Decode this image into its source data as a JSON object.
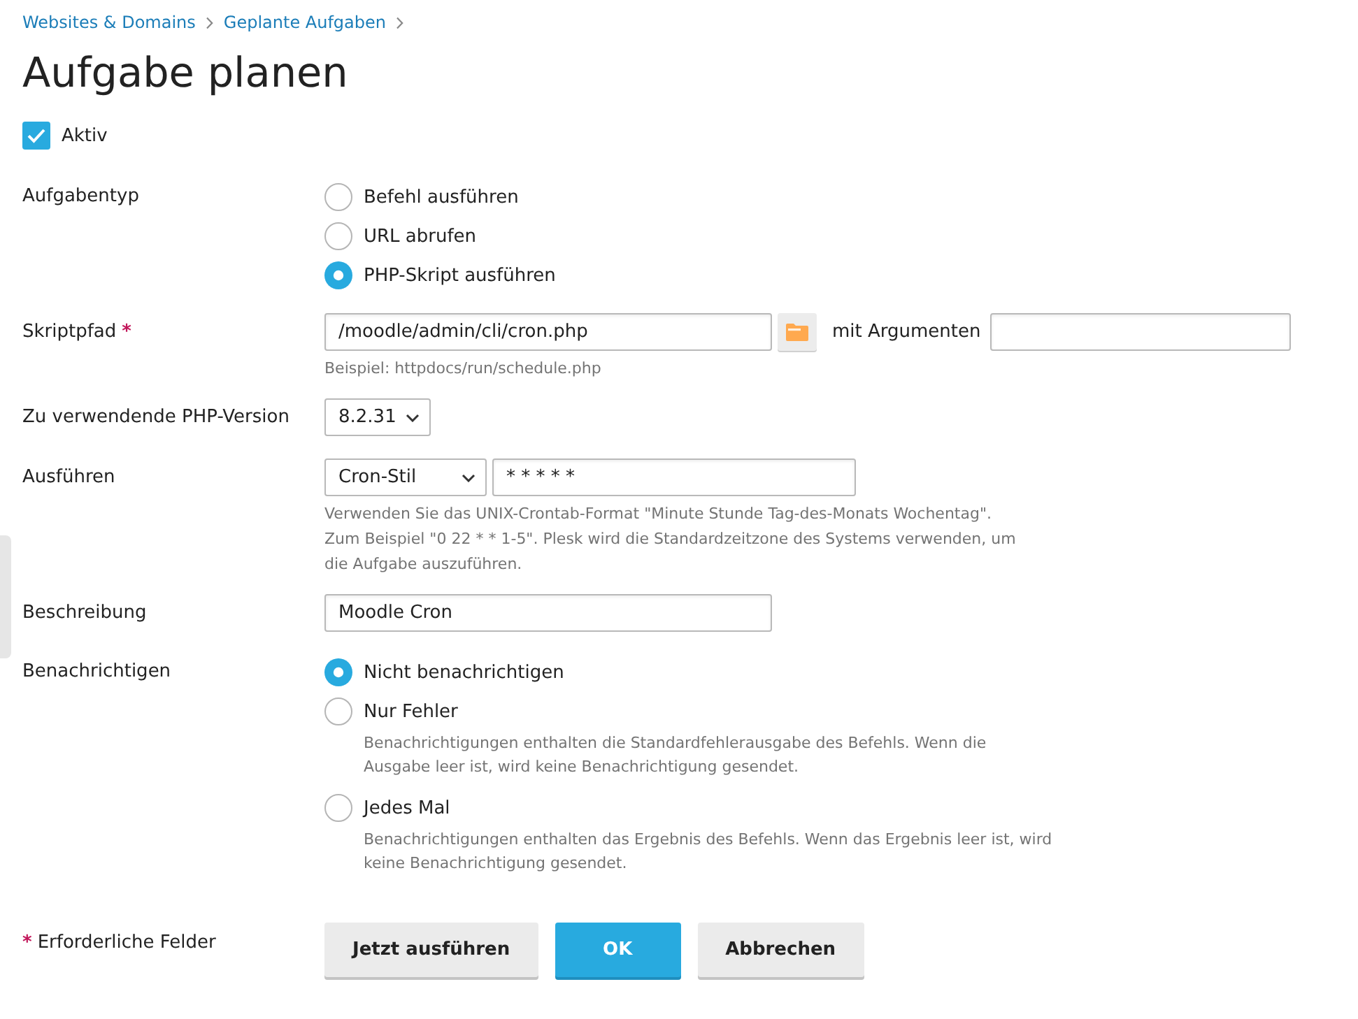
{
  "breadcrumbs": [
    {
      "label": "Websites & Domains"
    },
    {
      "label": "Geplante Aufgaben"
    }
  ],
  "title": "Aufgabe planen",
  "active": {
    "label": "Aktiv",
    "checked": true
  },
  "fields": [
    {
      "kind": "radio",
      "label": "Aufgabentyp",
      "options": [
        {
          "label": "Befehl ausführen",
          "selected": false
        },
        {
          "label": "URL abrufen",
          "selected": false
        },
        {
          "label": "PHP-Skript ausführen",
          "selected": true
        }
      ]
    },
    {
      "kind": "path",
      "label": "Skriptpfad",
      "required_mark": "*",
      "value": "/moodle/admin/cli/cron.php",
      "args_label": "mit Argumenten",
      "hint": "Beispiel: httpdocs/run/schedule.php"
    },
    {
      "kind": "select",
      "label": "Zu verwendende PHP-Version",
      "value": "8.2.31"
    },
    {
      "kind": "schedule",
      "label": "Ausführen",
      "mode": "Cron-Stil",
      "value": "* * * * *",
      "hint": "Verwenden Sie das UNIX-Crontab-Format \"Minute Stunde Tag-des-Monats Wochentag\". Zum Beispiel \"0 22 * * 1-5\". Plesk wird die Standardzeitzone des Systems verwenden, um die Aufgabe auszuführen."
    },
    {
      "kind": "text",
      "label": "Beschreibung",
      "value": "Moodle Cron"
    },
    {
      "kind": "radio",
      "label": "Benachrichtigen",
      "options": [
        {
          "label": "Nicht benachrichtigen",
          "selected": true
        },
        {
          "label": "Nur Fehler",
          "selected": false,
          "hint": "Benachrichtigungen enthalten die Standardfehlerausgabe des Befehls. Wenn die Ausgabe leer ist, wird keine Benachrichtigung gesendet."
        },
        {
          "label": "Jedes Mal",
          "selected": false,
          "hint": "Benachrichtigungen enthalten das Ergebnis des Befehls. Wenn das Ergebnis leer ist, wird keine Benachrichtigung gesendet."
        }
      ]
    }
  ],
  "required_note": {
    "mark": "*",
    "text": "Erforderliche Felder"
  },
  "buttons": [
    {
      "label": "Jetzt ausführen",
      "kind": "secondary"
    },
    {
      "label": "OK",
      "kind": "primary"
    },
    {
      "label": "Abbrechen",
      "kind": "secondary"
    }
  ]
}
